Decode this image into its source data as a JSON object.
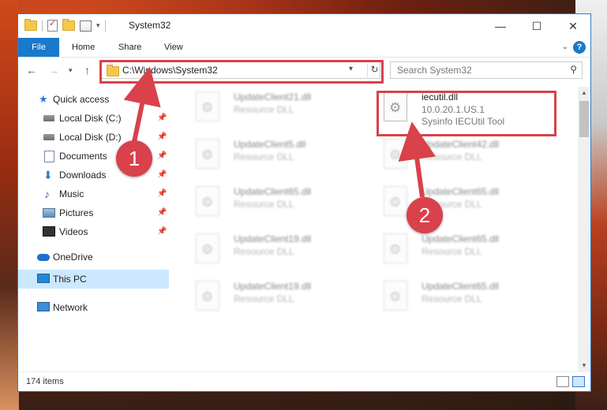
{
  "window": {
    "title": "System32",
    "controls": {
      "minimize": "—",
      "maximize": "☐",
      "close": "✕"
    }
  },
  "ribbon": {
    "tabs": [
      {
        "label": "File"
      },
      {
        "label": "Home"
      },
      {
        "label": "Share"
      },
      {
        "label": "View"
      }
    ]
  },
  "address_bar": {
    "path": "C:\\Windows\\System32"
  },
  "search": {
    "placeholder": "Search System32"
  },
  "sidebar": {
    "items": [
      {
        "label": "Quick access",
        "icon": "star-icon",
        "pinned": false
      },
      {
        "label": "Local Disk (C:)",
        "icon": "disk-icon",
        "pinned": true
      },
      {
        "label": "Local Disk (D:)",
        "icon": "disk-icon",
        "pinned": true
      },
      {
        "label": "Documents",
        "icon": "documents-icon",
        "pinned": true
      },
      {
        "label": "Downloads",
        "icon": "download-icon",
        "pinned": true
      },
      {
        "label": "Music",
        "icon": "music-icon",
        "pinned": true
      },
      {
        "label": "Pictures",
        "icon": "pictures-icon",
        "pinned": true
      },
      {
        "label": "Videos",
        "icon": "videos-icon",
        "pinned": true
      },
      {
        "label": "OneDrive",
        "icon": "cloud-icon",
        "pinned": false
      },
      {
        "label": "This PC",
        "icon": "computer-icon",
        "pinned": false,
        "selected": true
      },
      {
        "label": "Network",
        "icon": "network-icon",
        "pinned": false
      }
    ]
  },
  "files": [
    {
      "name": "UpdateClient21.dll",
      "type": "Resource DLL",
      "blurred": true
    },
    {
      "name": "iecutil.dll",
      "version": "10.0.20.1.US.1",
      "description": "Sysinfo IECUtil Tool",
      "blurred": false,
      "highlighted": true
    },
    {
      "name": "UpdateClient5.dll",
      "type": "Resource DLL",
      "blurred": true
    },
    {
      "name": "UpdateClient42.dll",
      "type": "Resource DLL",
      "blurred": true
    },
    {
      "name": "UpdateClient65.dll",
      "type": "Resource DLL",
      "blurred": true
    },
    {
      "name": "UpdateClient65.dll",
      "type": "Resource DLL",
      "blurred": true
    },
    {
      "name": "UpdateClient19.dll",
      "type": "Resource DLL",
      "blurred": true
    },
    {
      "name": "UpdateClient65.dll",
      "type": "Resource DLL",
      "blurred": true
    },
    {
      "name": "UpdateClient19.dll",
      "type": "Resource DLL",
      "blurred": true
    },
    {
      "name": "UpdateClient65.dll",
      "type": "Resource DLL",
      "blurred": true
    }
  ],
  "status": {
    "item_count": "174 items"
  },
  "annotations": [
    {
      "number": "1"
    },
    {
      "number": "2"
    }
  ],
  "colors": {
    "accent": "#1979ca",
    "highlight_box": "#d9414b",
    "selected_bg": "#cce8ff"
  }
}
